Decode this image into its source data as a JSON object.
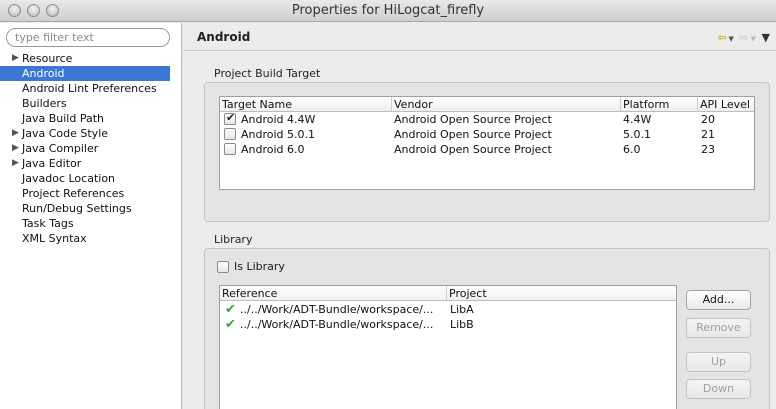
{
  "window": {
    "title": "Properties for HiLogcat_firefly"
  },
  "filter": {
    "placeholder": "type filter text"
  },
  "sidebar": {
    "items": [
      {
        "label": "Resource",
        "expandable": true,
        "selected": false
      },
      {
        "label": "Android",
        "expandable": false,
        "selected": true
      },
      {
        "label": "Android Lint Preferences",
        "expandable": false,
        "selected": false
      },
      {
        "label": "Builders",
        "expandable": false,
        "selected": false
      },
      {
        "label": "Java Build Path",
        "expandable": false,
        "selected": false
      },
      {
        "label": "Java Code Style",
        "expandable": true,
        "selected": false
      },
      {
        "label": "Java Compiler",
        "expandable": true,
        "selected": false
      },
      {
        "label": "Java Editor",
        "expandable": true,
        "selected": false
      },
      {
        "label": "Javadoc Location",
        "expandable": false,
        "selected": false
      },
      {
        "label": "Project References",
        "expandable": false,
        "selected": false
      },
      {
        "label": "Run/Debug Settings",
        "expandable": false,
        "selected": false
      },
      {
        "label": "Task Tags",
        "expandable": false,
        "selected": false
      },
      {
        "label": "XML Syntax",
        "expandable": false,
        "selected": false
      }
    ]
  },
  "page": {
    "title": "Android",
    "nav": {
      "back_icon": "arrow-back-icon",
      "forward_icon": "arrow-forward-icon",
      "menu_icon": "view-menu-icon"
    }
  },
  "build_target": {
    "label": "Project Build Target",
    "columns": [
      "Target Name",
      "Vendor",
      "Platform",
      "API Level"
    ],
    "rows": [
      {
        "checked": true,
        "name": "Android 4.4W",
        "vendor": "Android Open Source Project",
        "platform": "4.4W",
        "api": "20"
      },
      {
        "checked": false,
        "name": "Android 5.0.1",
        "vendor": "Android Open Source Project",
        "platform": "5.0.1",
        "api": "21"
      },
      {
        "checked": false,
        "name": "Android 6.0",
        "vendor": "Android Open Source Project",
        "platform": "6.0",
        "api": "23"
      }
    ]
  },
  "library": {
    "label": "Library",
    "is_library_label": "Is Library",
    "is_library_checked": false,
    "columns": [
      "Reference",
      "Project"
    ],
    "rows": [
      {
        "reference": "../../Work/ADT-Bundle/workspace/...",
        "project": "LibA",
        "status_icon": "check-icon"
      },
      {
        "reference": "../../Work/ADT-Bundle/workspace/...",
        "project": "LibB",
        "status_icon": "check-icon"
      }
    ],
    "buttons": {
      "add": "Add...",
      "remove": "Remove",
      "up": "Up",
      "down": "Down"
    }
  },
  "colors": {
    "selection": "#3d77d4",
    "check_ok": "#3aa72f"
  }
}
